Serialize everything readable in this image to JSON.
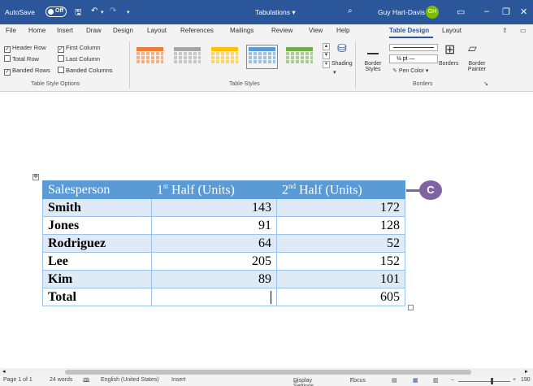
{
  "titlebar": {
    "autosave": "AutoSave",
    "autosave_state": "Off",
    "document_title": "Tabulations",
    "document_title_caret": "▾",
    "user_name": "Guy Hart-Davis",
    "user_initials": "GH"
  },
  "tabs": [
    "File",
    "Home",
    "Insert",
    "Draw",
    "Design",
    "Layout",
    "References",
    "Mailings",
    "Review",
    "View",
    "Help",
    "Table Design",
    "Layout"
  ],
  "ribbon": {
    "style_options": {
      "header_row": "Header Row",
      "first_column": "First Column",
      "total_row": "Total Row",
      "last_column": "Last Column",
      "banded_rows": "Banded Rows",
      "banded_columns": "Banded Columns",
      "group_label": "Table Style Options"
    },
    "table_styles": {
      "group_label": "Table Styles",
      "shading": "Shading"
    },
    "borders": {
      "border_styles": "Border Styles",
      "pen_weight": "½ pt",
      "pen_color": "Pen Color",
      "borders": "Borders",
      "border_painter": "Border Painter",
      "group_label": "Borders"
    }
  },
  "table": {
    "headers": [
      {
        "main": "Salesperson",
        "sup": ""
      },
      {
        "main": "1",
        "sup": "st",
        "rest": " Half (Units)"
      },
      {
        "main": "2",
        "sup": "nd",
        "rest": " Half (Units)"
      }
    ],
    "rows": [
      [
        "Smith",
        "143",
        "172"
      ],
      [
        "Jones",
        "91",
        "128"
      ],
      [
        "Rodriguez",
        "64",
        "52"
      ],
      [
        "Lee",
        "205",
        "152"
      ],
      [
        "Kim",
        "89",
        "101"
      ],
      [
        "Total",
        "",
        "605"
      ]
    ]
  },
  "callout_label": "C",
  "status": {
    "page": "Page 1 of 1",
    "words": "24 words",
    "language": "English (United States)",
    "mode": "Insert",
    "display_settings": "Display Settings",
    "focus": "Focus",
    "zoom": "190"
  },
  "colors": {
    "title_bar": "#2b579a",
    "table_header": "#5b9bd5",
    "band": "#deeaf6",
    "callout": "#8064a2"
  }
}
